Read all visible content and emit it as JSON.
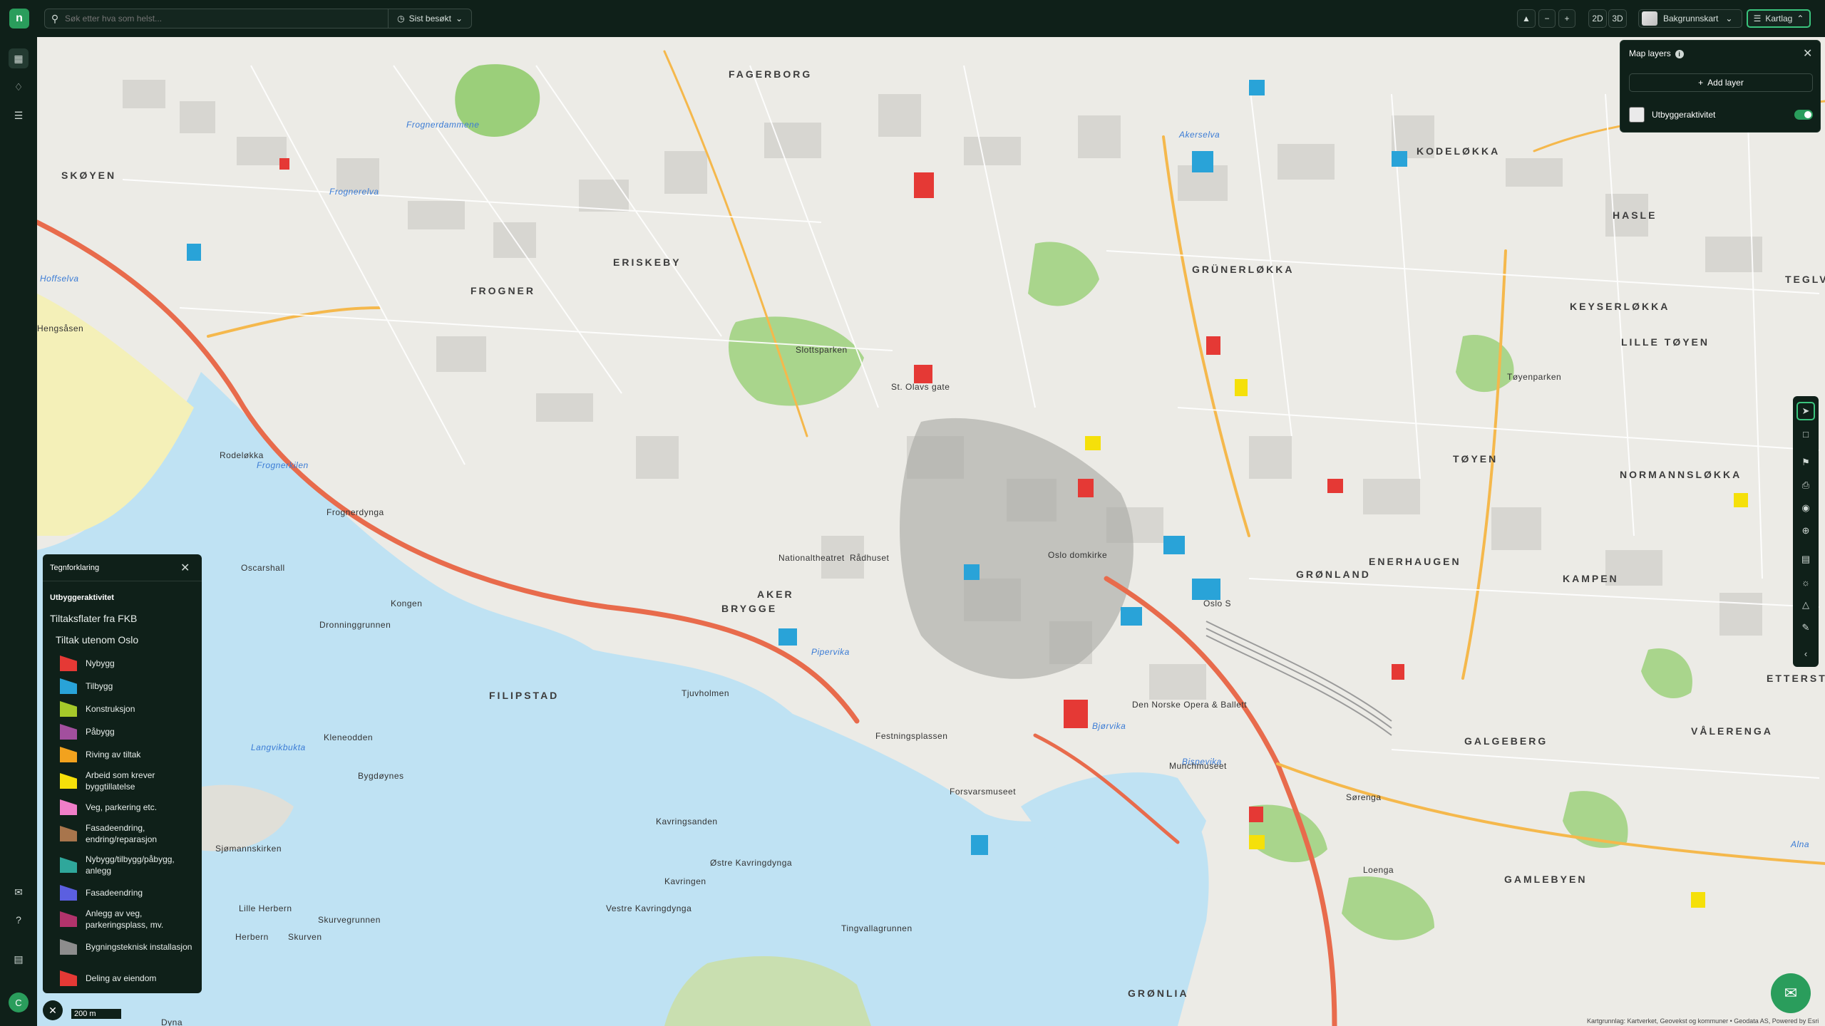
{
  "topbar": {
    "search_placeholder": "Søk etter hva som helst...",
    "recent_label": "Sist besøkt",
    "zoom_minus": "−",
    "zoom_plus": "+",
    "view_2d": "2D",
    "view_3d": "3D",
    "basemap_label": "Bakgrunnskart",
    "layers_label": "Kartlag"
  },
  "sidebar": {
    "avatar_initial": "C"
  },
  "map_layers": {
    "title": "Map layers",
    "add_label": "Add layer",
    "layers": [
      {
        "name": "Utbyggeraktivitet",
        "enabled": true
      }
    ]
  },
  "legend": {
    "title": "Tegnforklaring",
    "layer_name": "Utbyggeraktivitet",
    "group1": "Tiltaksflater fra FKB",
    "group2": "Tiltak utenom Oslo",
    "items": [
      {
        "label": "Nybygg",
        "color": "#e53935"
      },
      {
        "label": "Tilbygg",
        "color": "#29a3d8"
      },
      {
        "label": "Konstruksjon",
        "color": "#a6c92a"
      },
      {
        "label": "Påbygg",
        "color": "#a24f9e"
      },
      {
        "label": "Riving av tiltak",
        "color": "#f2a21e"
      },
      {
        "label": "Arbeid som krever byggtillatelse",
        "color": "#f5e00a"
      },
      {
        "label": "Veg, parkering etc.",
        "color": "#f07ec8"
      },
      {
        "label": "Fasadeendring, endring/reparasjon",
        "color": "#a8754c"
      },
      {
        "label": "Nybygg/tilbygg/påbygg, anlegg",
        "color": "#2fa79b"
      },
      {
        "label": "Fasadeendring",
        "color": "#5b5fe0"
      },
      {
        "label": "Anlegg av veg, parkeringsplass, mv.",
        "color": "#b2336b"
      },
      {
        "label": "Bygningsteknisk installasjon",
        "color": "#8d8d8d"
      },
      {
        "label": "Deling av eiendom",
        "color": "#e53935"
      }
    ]
  },
  "map": {
    "scale_label": "200 m",
    "attribution": "Kartgrunnlag: Kartverket, Geovekst og kommuner • Geodata AS, Powered by Esri",
    "labels": {
      "fagerborg": "FAGERBORG",
      "kodelokka": "KODELØKKA",
      "skoyen": "SKØYEN",
      "eriksberg": "ERISKEBY",
      "frogner": "FROGNER",
      "grunerlokka": "GRÜNERLØKKA",
      "hasle": "HASLE",
      "keyserlokka": "KEYSERLØKKA",
      "lille_toyen": "LILLE TØYEN",
      "teglve": "TEGLVE",
      "toyen": "TØYEN",
      "normannslokka": "NORMANNSLØKKA",
      "gronland": "GRØNLAND",
      "enerhaugen": "ENERHAUGEN",
      "kampen": "KAMPEN",
      "etterstad": "ETTERSTAD",
      "aker_brygge_1": "AKER",
      "aker_brygge_2": "BRYGGE",
      "filipstad": "FILIPSTAD",
      "galgeberg": "GALGEBERG",
      "valerenga": "VÅLERENGA",
      "gamlebyen": "GAMLEBYEN",
      "gronlia": "GRØNLIA",
      "frognerelva": "Frognerelva",
      "akerselva": "Akerselva",
      "frognerkilen": "Frognerkilen",
      "pipervika": "Pipervika",
      "bjorvika": "Bjørvika",
      "bispevika": "Bispevika",
      "langvikbukta": "Langvikbukta",
      "hoffselva": "Hoffselva",
      "alna": "Alna",
      "frognerdammene": "Frognerdammene",
      "hengsasen": "Hengsåsen",
      "rodelakka": "Rodeløkka",
      "frognerdynga": "Frognerdynga",
      "oscarshall": "Oscarshall",
      "kongen": "Kongen",
      "dronningrunnen": "Dronninggrunnen",
      "kavringsanden": "Kavringsanden",
      "ostre_kavringdynga": "Østre Kavringdynga",
      "kavringen": "Kavringen",
      "vestre_kavringdynga": "Vestre Kavringdynga",
      "tingvallagrunnen": "Tingvallagrunnen",
      "lille_herbern": "Lille Herbern",
      "skurvegrunnen": "Skurvegrunnen",
      "herbern": "Herbern",
      "skurven": "Skurven",
      "kleneodden": "Kleneodden",
      "bygdoynes": "Bygdøynes",
      "sjomannskirken": "Sjømannskirken",
      "dyna": "Dyna",
      "tjuvholmen": "Tjuvholmen",
      "festningsplassen": "Festningsplassen",
      "forsvarsmuseet": "Forsvarsmuseet",
      "operaen": "Den Norske Opera & Ballett",
      "munchmuseet": "Munchmuseet",
      "sorenga": "Sørenga",
      "loenga": "Loenga",
      "jernbanetorget": "Oslo S",
      "slottsparken": "Slottsparken",
      "oslo_domkirke": "Oslo domkirke",
      "radhuset": "Rådhuset",
      "nationaltheatret": "Nationaltheatret",
      "st_olavs_gate": "St. Olavs gate",
      "toyenparken": "Tøyenparken"
    }
  }
}
